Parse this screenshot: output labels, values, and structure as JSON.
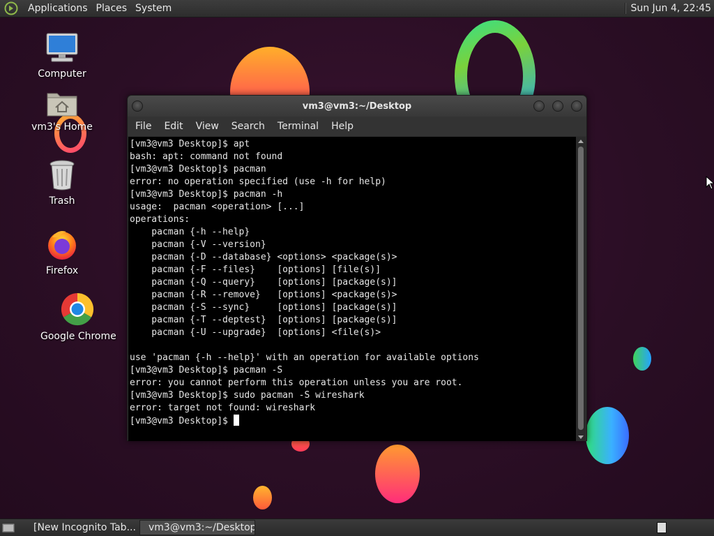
{
  "top_panel": {
    "menus": [
      "Applications",
      "Places",
      "System"
    ],
    "clock": "Sun Jun  4, 22:45"
  },
  "desktop_icons": [
    {
      "label": "Computer",
      "icon": "computer-icon"
    },
    {
      "label": "vm3's Home",
      "icon": "home-folder-icon"
    },
    {
      "label": "Trash",
      "icon": "trash-icon"
    },
    {
      "label": "Firefox",
      "icon": "firefox-icon"
    },
    {
      "label": "Google Chrome",
      "icon": "chrome-icon"
    }
  ],
  "terminal": {
    "title": "vm3@vm3:~/Desktop",
    "menu": [
      "File",
      "Edit",
      "View",
      "Search",
      "Terminal",
      "Help"
    ],
    "lines": [
      "[vm3@vm3 Desktop]$ apt",
      "bash: apt: command not found",
      "[vm3@vm3 Desktop]$ pacman",
      "error: no operation specified (use -h for help)",
      "[vm3@vm3 Desktop]$ pacman -h",
      "usage:  pacman <operation> [...]",
      "operations:",
      "    pacman {-h --help}",
      "    pacman {-V --version}",
      "    pacman {-D --database} <options> <package(s)>",
      "    pacman {-F --files}    [options] [file(s)]",
      "    pacman {-Q --query}    [options] [package(s)]",
      "    pacman {-R --remove}   [options] <package(s)>",
      "    pacman {-S --sync}     [options] [package(s)]",
      "    pacman {-T --deptest}  [options] [package(s)]",
      "    pacman {-U --upgrade}  [options] <file(s)>",
      "",
      "use 'pacman {-h --help}' with an operation for available options",
      "[vm3@vm3 Desktop]$ pacman -S",
      "error: you cannot perform this operation unless you are root.",
      "[vm3@vm3 Desktop]$ sudo pacman -S wireshark",
      "error: target not found: wireshark"
    ],
    "prompt": "[vm3@vm3 Desktop]$ "
  },
  "taskbar": {
    "tasks": [
      {
        "label": "[New Incognito Tab...",
        "icon": "chrome-icon",
        "active": false
      },
      {
        "label": "vm3@vm3:~/Desktop",
        "icon": "terminal-icon",
        "active": true
      }
    ]
  }
}
